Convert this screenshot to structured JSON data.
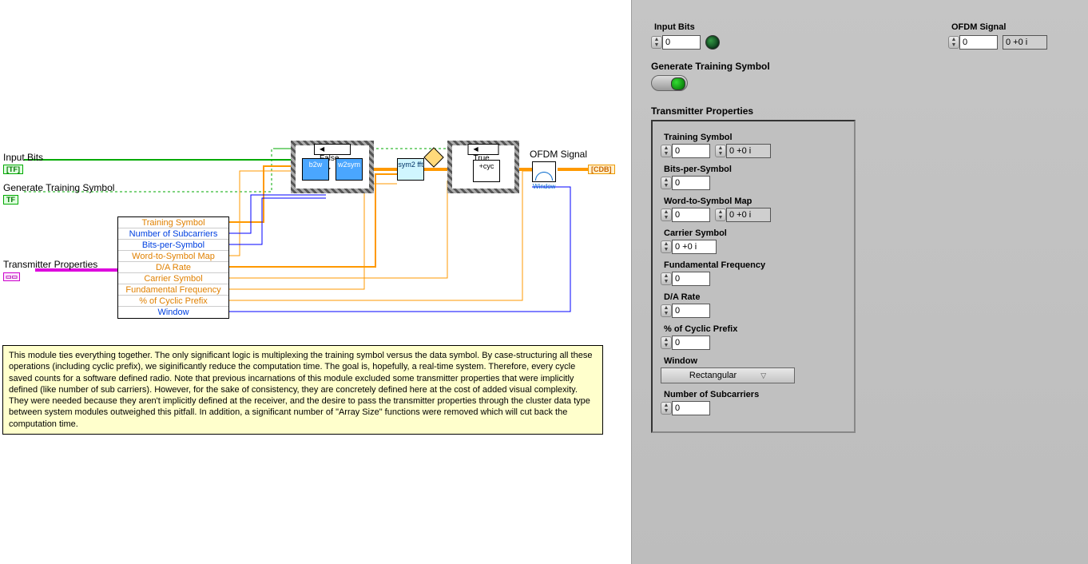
{
  "left": {
    "terminals": {
      "input_bits": "Input Bits",
      "gen_train": "Generate Training Symbol",
      "tx_props": "Transmitter Properties",
      "ofdm_sig": "OFDM Signal"
    },
    "unbundle": [
      {
        "text": "Training Symbol",
        "cls": "orange"
      },
      {
        "text": "Number of Subcarriers",
        "cls": "blue"
      },
      {
        "text": "Bits-per-Symbol",
        "cls": "blue"
      },
      {
        "text": "Word-to-Symbol Map",
        "cls": "orange"
      },
      {
        "text": "D/A Rate",
        "cls": "orange"
      },
      {
        "text": "Carrier Symbol",
        "cls": "orange"
      },
      {
        "text": "Fundamental Frequency",
        "cls": "orange"
      },
      {
        "text": "% of Cyclic Prefix",
        "cls": "orange"
      },
      {
        "text": "Window",
        "cls": "blue"
      }
    ],
    "case1_label": "◀ False ▼▶",
    "case2_label": "◀ True ▼▶",
    "subvis": {
      "b2w": "b2w",
      "w2sym": "w2sym",
      "sym2fft": "sym2\nfft",
      "cyc": "+cyc"
    },
    "window_icon_label": "Window",
    "comment": "This module ties everything together. The only significant logic is multiplexing the training symbol versus the data symbol. By case-structuring all these operations (including cyclic prefix), we siginificantly reduce the computation time. The goal is, hopefully, a real-time system. Therefore, every cycle saved counts for a software defined radio. Note that previous incarnations of this module excluded some transmitter properties that were implicitly defined (like number of sub carriers). However, for the sake of consistency, they are concretely defined here at the cost of added visual complexity. They were needed because they aren't implicitly defined at the receiver, and the desire to pass the transmitter properties through the cluster data type between system modules outweighed this pitfall. In addition, a significant number of \"Array Size\" functions were removed which will cut back the computation time."
  },
  "panel": {
    "input_bits_label": "Input Bits",
    "ofdm_label": "OFDM Signal",
    "gen_train_label": "Generate Training Symbol",
    "tx_props_label": "Transmitter Properties",
    "defaults": {
      "idx0": "0",
      "complex0": "0 +0 i"
    },
    "cluster": {
      "training_symbol": "Training Symbol",
      "bits_per_symbol": "Bits-per-Symbol",
      "w2s_map": "Word-to-Symbol Map",
      "carrier_symbol": "Carrier Symbol",
      "fund_freq": "Fundamental Frequency",
      "da_rate": "D/A Rate",
      "cyc_prefix": "% of Cyclic Prefix",
      "window": "Window",
      "window_value": "Rectangular",
      "num_subc": "Number of Subcarriers"
    }
  }
}
